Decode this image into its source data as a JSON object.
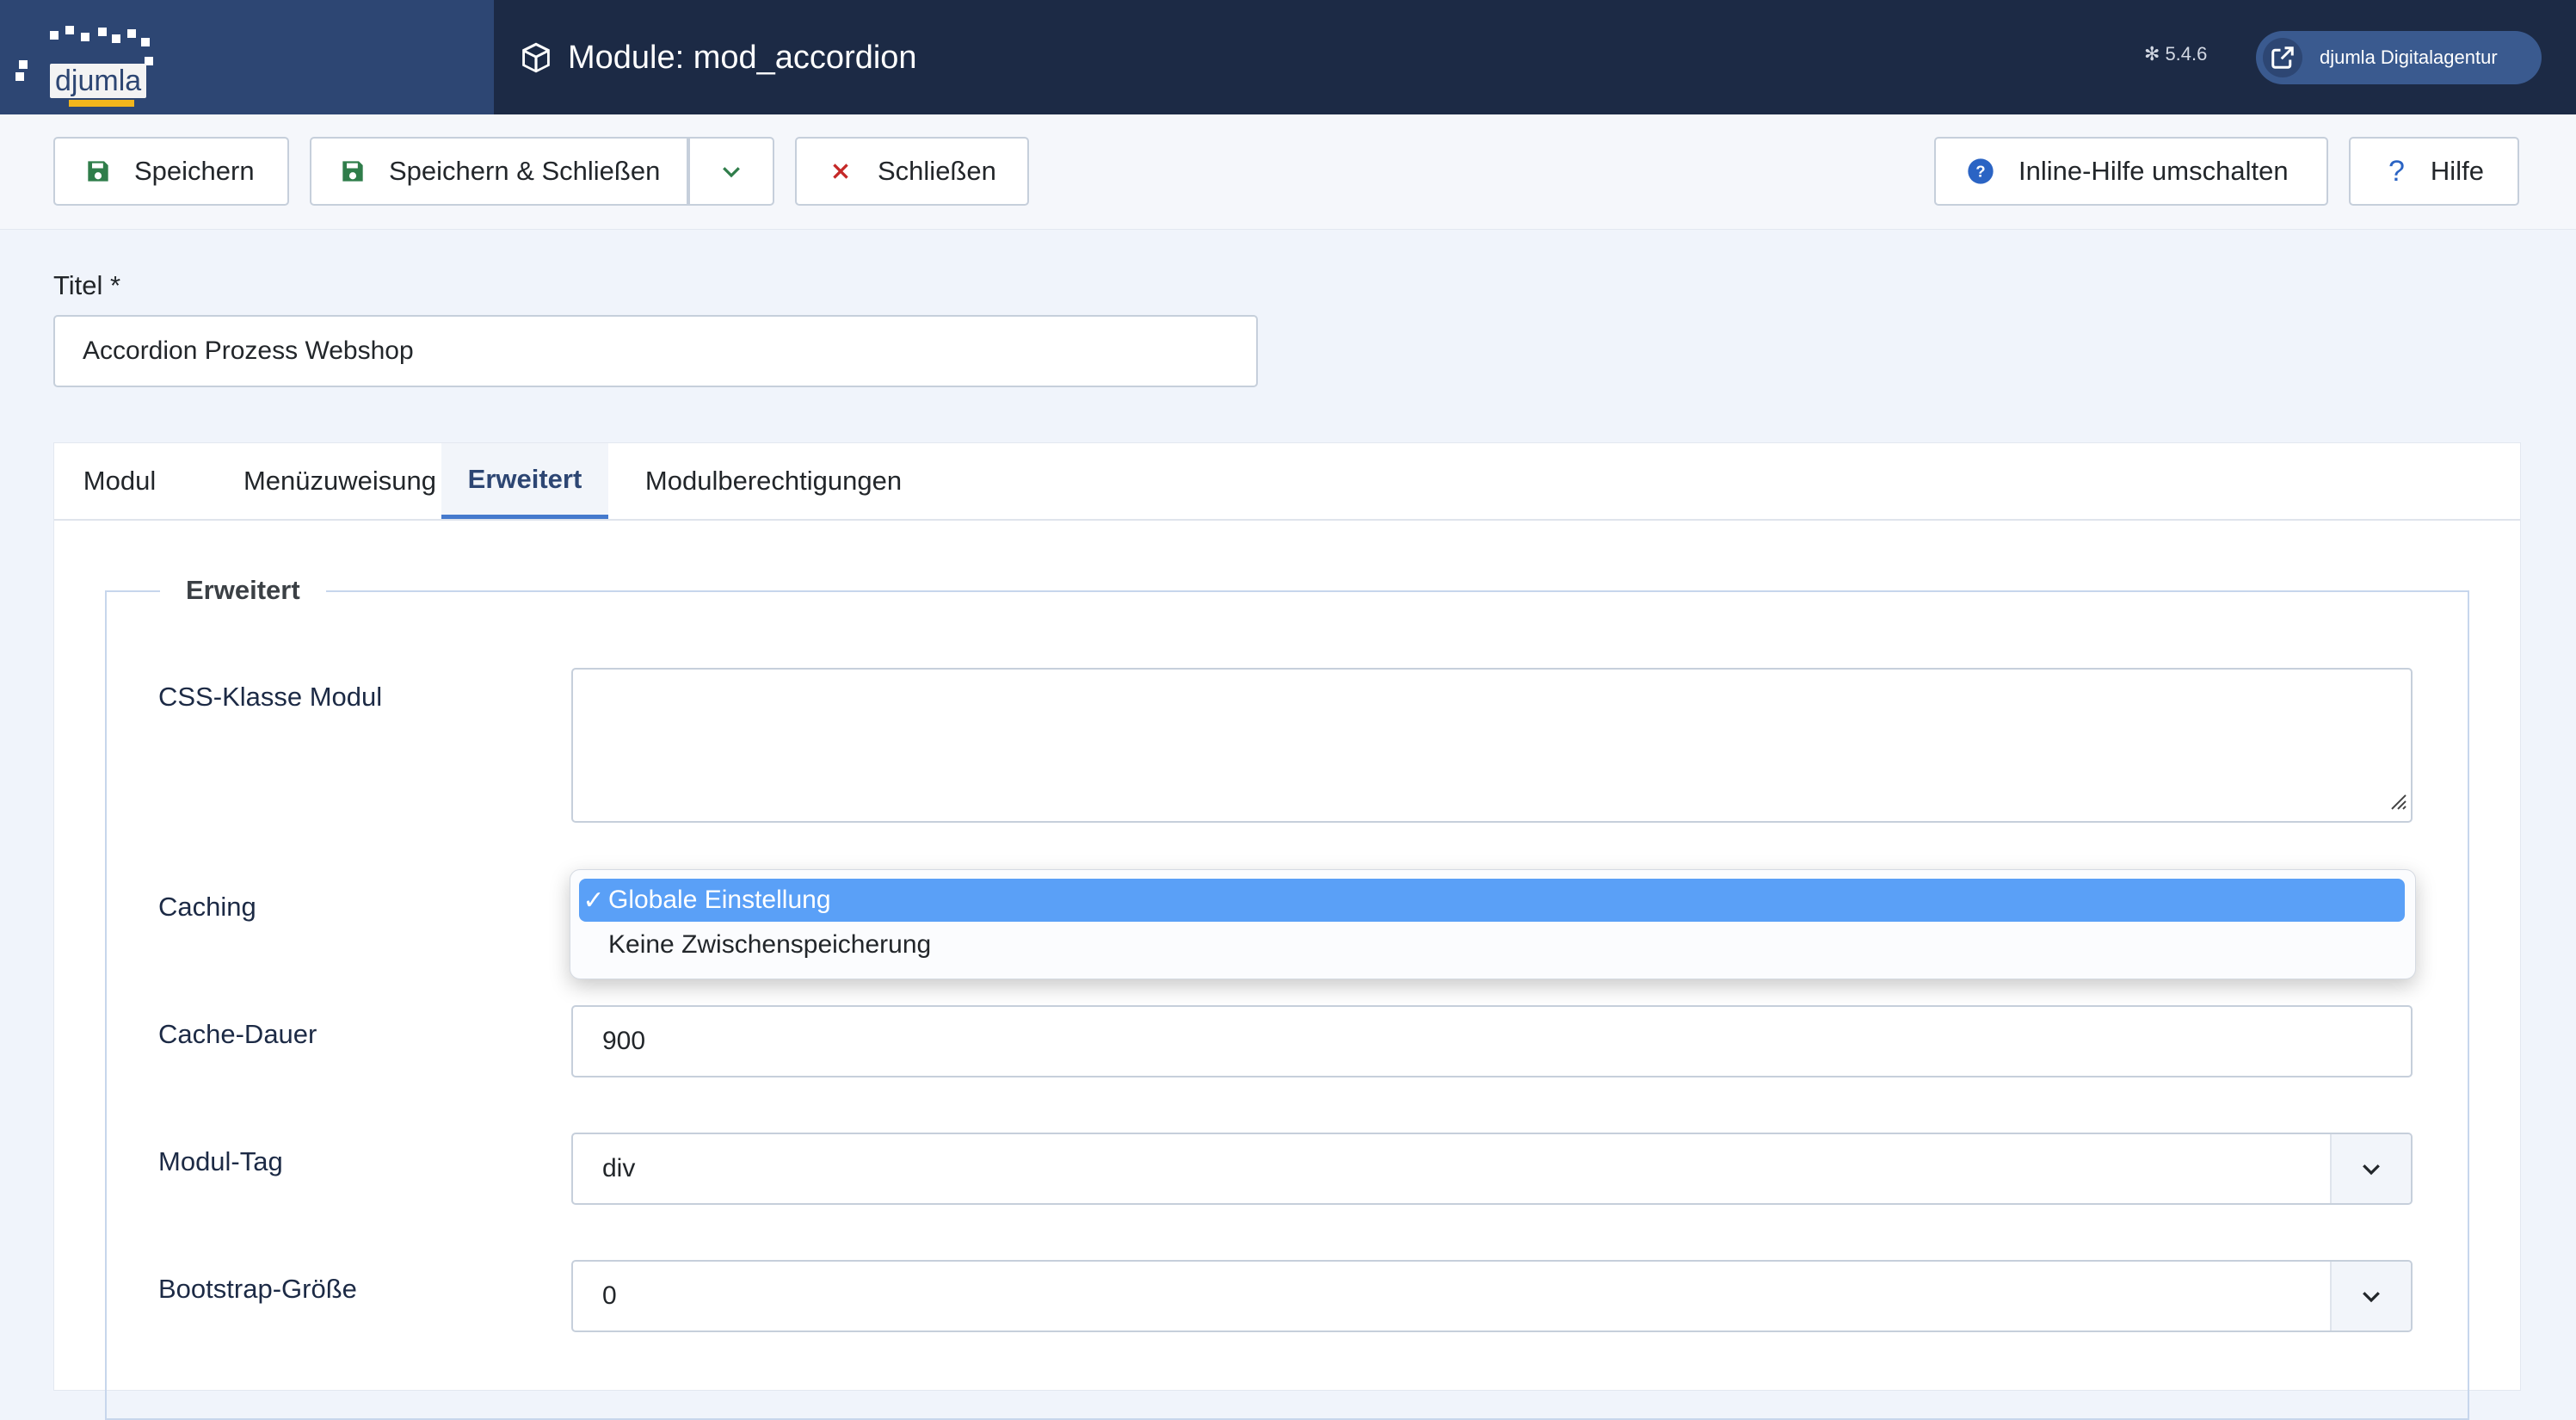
{
  "header": {
    "logo_text": "djumla",
    "title": "Module: mod_accordion",
    "version": "5.4.6",
    "user_label": "djumla Digitalagentur",
    "colors": {
      "header_bg": "#1c2a45",
      "logo_bg": "#2d4673",
      "accent": "#457acd"
    }
  },
  "toolbar": {
    "save": "Speichern",
    "save_close": "Speichern & Schließen",
    "close": "Schließen",
    "inline_help": "Inline-Hilfe umschalten",
    "help": "Hilfe"
  },
  "form": {
    "title_label": "Titel *",
    "title_value": "Accordion Prozess Webshop"
  },
  "tabs": [
    {
      "label": "Modul",
      "active": false
    },
    {
      "label": "Menüzuweisung",
      "active": false
    },
    {
      "label": "Erweitert",
      "active": true
    },
    {
      "label": "Modulberechtigungen",
      "active": false
    }
  ],
  "advanced": {
    "legend": "Erweitert",
    "css_class_label": "CSS-Klasse Modul",
    "css_class_value": "",
    "caching_label": "Caching",
    "caching_options": [
      {
        "label": "Globale Einstellung",
        "selected": true,
        "check": "✓"
      },
      {
        "label": "Keine Zwischenspeicherung",
        "selected": false
      }
    ],
    "cache_time_label": "Cache-Dauer",
    "cache_time_value": "900",
    "module_tag_label": "Modul-Tag",
    "module_tag_value": "div",
    "bootstrap_size_label": "Bootstrap-Größe",
    "bootstrap_size_value": "0"
  }
}
